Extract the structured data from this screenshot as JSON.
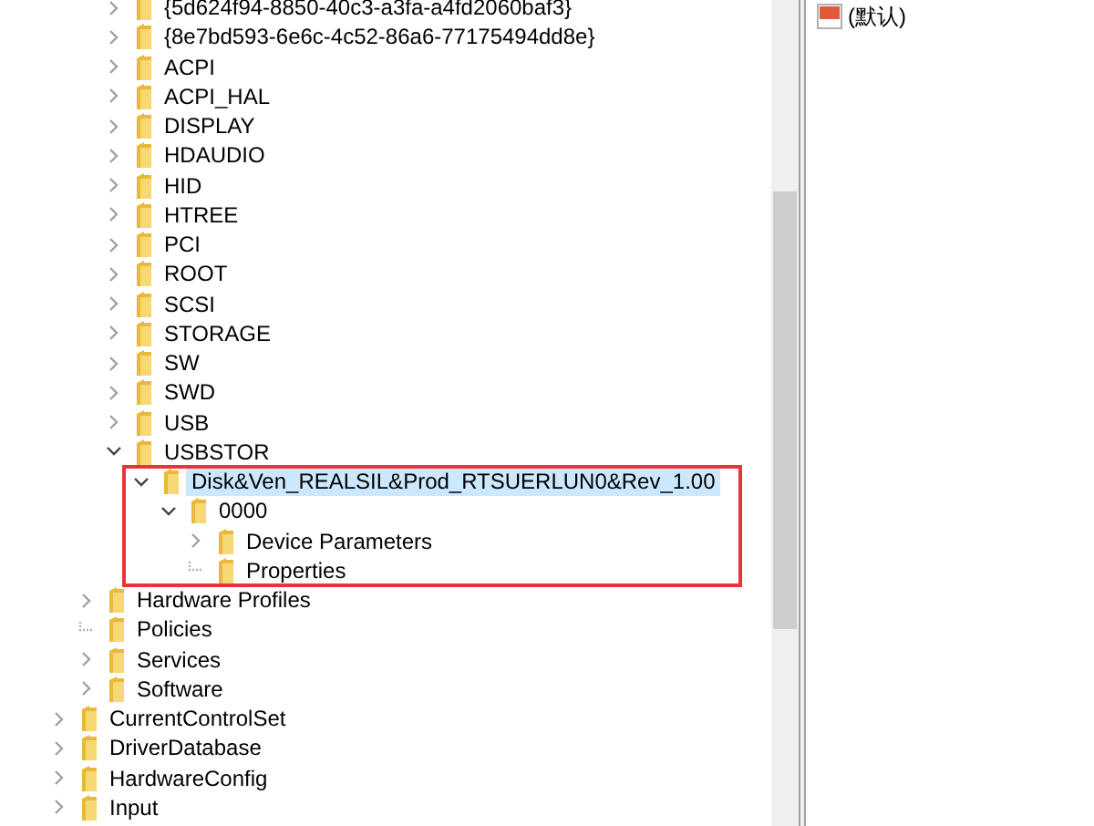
{
  "tree": [
    {
      "children": [
        {
          "children": [
            {
              "label": "{5d624f94-8850-40c3-a3fa-a4fd2060baf3}",
              "expandable": true,
              "expanded": false,
              "selected": false
            },
            {
              "label": "{8e7bd593-6e6c-4c52-86a6-77175494dd8e}",
              "expandable": true,
              "expanded": false,
              "selected": false
            },
            {
              "label": "ACPI",
              "expandable": true,
              "expanded": false,
              "selected": false
            },
            {
              "label": "ACPI_HAL",
              "expandable": true,
              "expanded": false,
              "selected": false
            },
            {
              "label": "DISPLAY",
              "expandable": true,
              "expanded": false,
              "selected": false
            },
            {
              "label": "HDAUDIO",
              "expandable": true,
              "expanded": false,
              "selected": false
            },
            {
              "label": "HID",
              "expandable": true,
              "expanded": false,
              "selected": false
            },
            {
              "label": "HTREE",
              "expandable": true,
              "expanded": false,
              "selected": false
            },
            {
              "label": "PCI",
              "expandable": true,
              "expanded": false,
              "selected": false
            },
            {
              "label": "ROOT",
              "expandable": true,
              "expanded": false,
              "selected": false
            },
            {
              "label": "SCSI",
              "expandable": true,
              "expanded": false,
              "selected": false
            },
            {
              "label": "STORAGE",
              "expandable": true,
              "expanded": false,
              "selected": false
            },
            {
              "label": "SW",
              "expandable": true,
              "expanded": false,
              "selected": false
            },
            {
              "label": "SWD",
              "expandable": true,
              "expanded": false,
              "selected": false
            },
            {
              "label": "USB",
              "expandable": true,
              "expanded": false,
              "selected": false
            },
            {
              "label": "USBSTOR",
              "expandable": true,
              "expanded": true,
              "selected": false,
              "children": [
                {
                  "label": "Disk&Ven_REALSIL&Prod_RTSUERLUN0&Rev_1.00",
                  "expandable": true,
                  "expanded": true,
                  "selected": true,
                  "framed": true,
                  "children": [
                    {
                      "label": "0000",
                      "expandable": true,
                      "expanded": true,
                      "selected": false,
                      "children": [
                        {
                          "label": "Device Parameters",
                          "expandable": true,
                          "expanded": false,
                          "selected": false
                        },
                        {
                          "label": "Properties",
                          "expandable": false,
                          "selected": false
                        }
                      ]
                    }
                  ]
                }
              ]
            }
          ]
        },
        {
          "label": "Hardware Profiles",
          "expandable": true,
          "expanded": false,
          "selected": false
        },
        {
          "label": "Policies",
          "expandable": false,
          "selected": false
        },
        {
          "label": "Services",
          "expandable": true,
          "expanded": false,
          "selected": false
        },
        {
          "label": "Software",
          "expandable": true,
          "expanded": false,
          "selected": false
        }
      ]
    },
    {
      "label": "CurrentControlSet",
      "expandable": true,
      "expanded": false,
      "selected": false
    },
    {
      "label": "DriverDatabase",
      "expandable": true,
      "expanded": false,
      "selected": false
    },
    {
      "label": "HardwareConfig",
      "expandable": true,
      "expanded": false,
      "selected": false
    },
    {
      "label": "Input",
      "expandable": true,
      "expanded": false,
      "selected": false
    }
  ],
  "values": [
    {
      "name": "(默认)"
    }
  ]
}
